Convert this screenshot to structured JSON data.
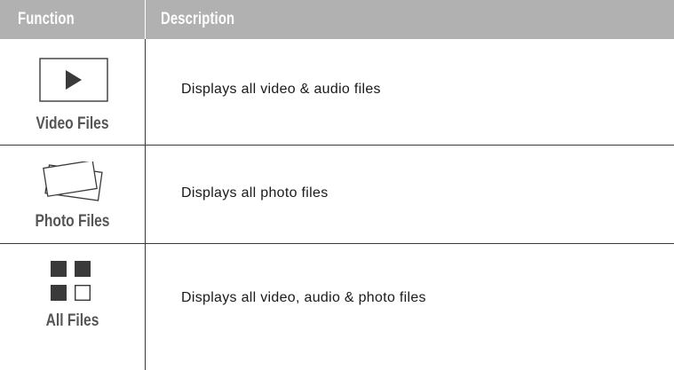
{
  "header": {
    "function_label": "Function",
    "description_label": "Description"
  },
  "rows": [
    {
      "icon": "play-icon",
      "function": "Video Files",
      "description": "Displays all video & audio files"
    },
    {
      "icon": "photos-icon",
      "function": "Photo Files",
      "description": "Displays all photo files"
    },
    {
      "icon": "grid-icon",
      "function": "All Files",
      "description": "Displays all video, audio & photo files"
    }
  ],
  "colors": {
    "header_bg": "#b1b1b1",
    "header_text": "#ffffff",
    "label_text": "#555555",
    "icon_fill": "#3a3a3a",
    "rule": "#3a3a3a"
  }
}
